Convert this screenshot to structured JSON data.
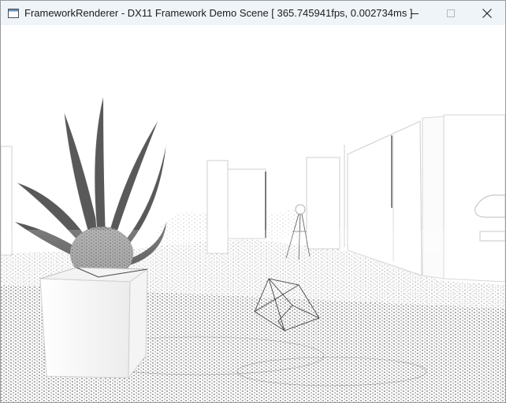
{
  "window": {
    "title": "FrameworkRenderer - DX11 Framework Demo Scene [ 365.745941fps, 0.002734ms ]",
    "icon": "app-window-icon",
    "controls": {
      "minimize_icon": "minimize-icon",
      "maximize_icon": "maximize-icon",
      "close_icon": "close-icon",
      "maximize_enabled": false
    }
  },
  "scene": {
    "description_icon": "rendered-3d-scene",
    "colors": {
      "background": "#ffffff",
      "ground_stipple": "#5a5a5a",
      "plant_dark": "#3a3a3a",
      "titlebar": "#eff4f9"
    }
  }
}
